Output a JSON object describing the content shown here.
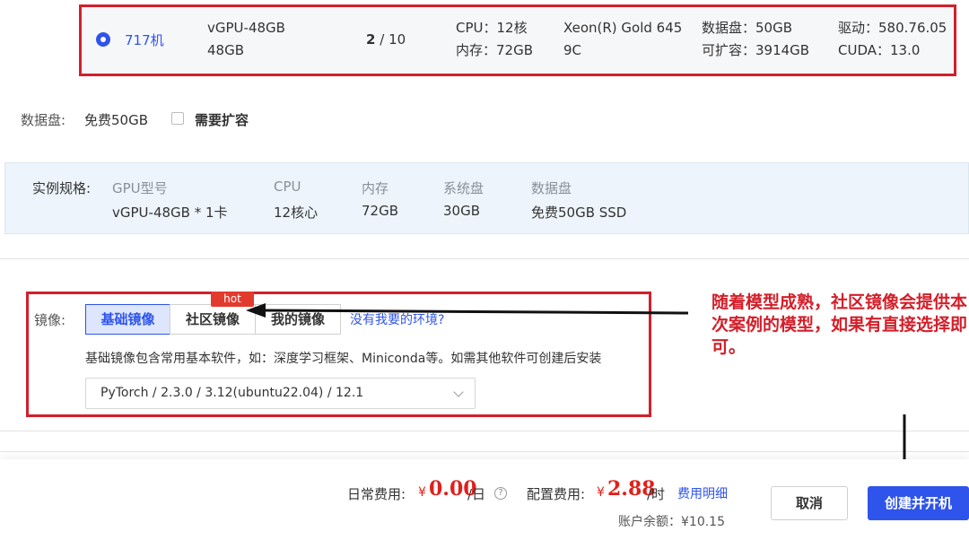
{
  "machine": {
    "name": "717机",
    "gpu_model": "vGPU-48GB",
    "gpu_memory": "48GB",
    "gpu_available": "2",
    "gpu_separator": "/",
    "gpu_total": "10",
    "cpu": "CPU：12核",
    "ram": "内存：72GB",
    "cpu_model_line1": "Xeon(R) Gold 645",
    "cpu_model_line2": "9C",
    "data_disk": "数据盘：50GB",
    "expandable": "可扩容：3914GB",
    "driver": "驱动：580.76.05",
    "cuda": "CUDA：13.0"
  },
  "data_disk_row": {
    "label": "数据盘:",
    "value": "免费50GB",
    "expand_label": "需要扩容"
  },
  "spec": {
    "label": "实例规格:",
    "columns": [
      {
        "head": "GPU型号",
        "value": "vGPU-48GB * 1卡"
      },
      {
        "head": "CPU",
        "value": "12核心"
      },
      {
        "head": "内存",
        "value": "72GB"
      },
      {
        "head": "系统盘",
        "value": "30GB"
      },
      {
        "head": "数据盘",
        "value": "免费50GB SSD"
      }
    ]
  },
  "mirror": {
    "label": "镜像:",
    "tabs": [
      "基础镜像",
      "社区镜像",
      "我的镜像"
    ],
    "hot_badge": "hot",
    "missing_link": "没有我要的环境?",
    "description": "基础镜像包含常用基本软件，如：深度学习框架、Miniconda等。如需其他软件可创建后安装",
    "selected": "PyTorch / 2.3.0 / 3.12(ubuntu22.04) / 12.1"
  },
  "annotation": {
    "text": "随着模型成熟，社区镜像会提供本次案例的模型，如果有直接选择即可。"
  },
  "footer": {
    "daily_label": "日常费用:",
    "daily_currency": "¥",
    "daily_price": "0.00",
    "daily_unit": "/日",
    "help_glyph": "?",
    "config_label": "配置费用:",
    "config_currency": "¥",
    "config_price": "2.88",
    "config_unit": "/时",
    "details_link": "费用明细",
    "balance": "账户余额：¥10.15",
    "cancel": "取消",
    "create": "创建并开机"
  },
  "colors": {
    "accent": "#2f54eb",
    "highlight_red": "#d31f2a",
    "price_red": "#e0201b"
  }
}
